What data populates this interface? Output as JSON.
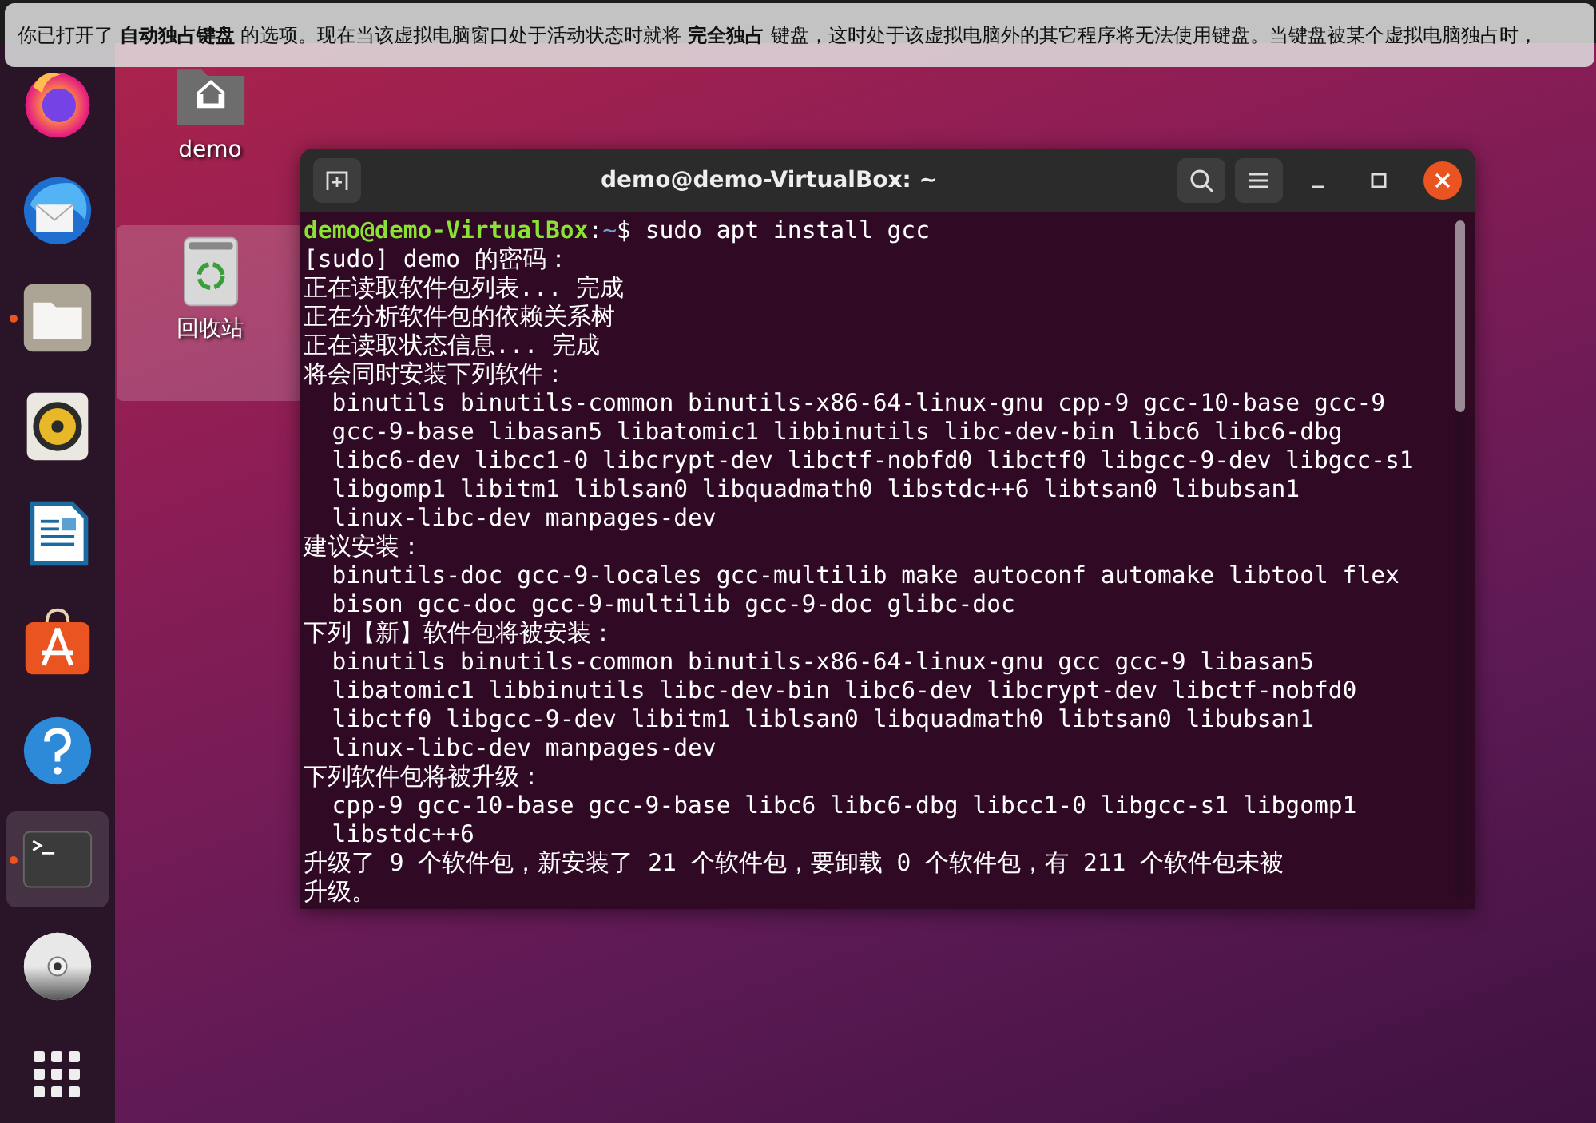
{
  "notification": {
    "text": "你已打开了 **自动独占键盘** 的选项。现在当该虚拟电脑窗口处于活动状态时就将 **完全独占** 键盘，这时处于该虚拟电脑外的其它程序将无法使用键盘。当键盘被某个虚拟电脑独占时，"
  },
  "dock": {
    "items": [
      {
        "kind": "firefox",
        "running": false,
        "selected": false
      },
      {
        "kind": "thunderbird",
        "running": false,
        "selected": false
      },
      {
        "kind": "files",
        "running": true,
        "selected": false
      },
      {
        "kind": "rhythmbox",
        "running": false,
        "selected": false
      },
      {
        "kind": "writer",
        "running": false,
        "selected": false
      },
      {
        "kind": "software",
        "running": false,
        "selected": false
      },
      {
        "kind": "help",
        "running": false,
        "selected": false
      },
      {
        "kind": "terminal",
        "running": true,
        "selected": true
      },
      {
        "kind": "disc",
        "running": false,
        "selected": false
      },
      {
        "kind": "apps",
        "running": false,
        "selected": false
      }
    ]
  },
  "desktop": {
    "icons": [
      {
        "kind": "home",
        "label": "demo",
        "selected": false
      },
      {
        "kind": "trash",
        "label": "回收站",
        "selected": true
      }
    ]
  },
  "terminal": {
    "title": "demo@demo-VirtualBox: ~",
    "lines": [
      {
        "kind": "prompt",
        "segments": [
          {
            "text": "demo@demo-VirtualBox",
            "color": "#8ae234"
          },
          {
            "text": ":",
            "color": "#ffffff"
          },
          {
            "text": "~",
            "color": "#729fcf"
          },
          {
            "text": "$ sudo apt install gcc",
            "color": "#ffffff"
          }
        ]
      },
      {
        "kind": "text",
        "text": "[sudo] demo 的密码："
      },
      {
        "kind": "text",
        "text": "正在读取软件包列表... 完成"
      },
      {
        "kind": "text",
        "text": "正在分析软件包的依赖关系树"
      },
      {
        "kind": "text",
        "text": "正在读取状态信息... 完成"
      },
      {
        "kind": "text",
        "text": "将会同时安装下列软件："
      },
      {
        "kind": "package",
        "text": "binutils binutils-common binutils-x86-64-linux-gnu cpp-9 gcc-10-base gcc-9"
      },
      {
        "kind": "package",
        "text": "gcc-9-base libasan5 libatomic1 libbinutils libc-dev-bin libc6 libc6-dbg"
      },
      {
        "kind": "package",
        "text": "libc6-dev libcc1-0 libcrypt-dev libctf-nobfd0 libctf0 libgcc-9-dev libgcc-s1"
      },
      {
        "kind": "package",
        "text": "libgomp1 libitm1 liblsan0 libquadmath0 libstdc++6 libtsan0 libubsan1"
      },
      {
        "kind": "package",
        "text": "linux-libc-dev manpages-dev"
      },
      {
        "kind": "text",
        "text": "建议安装："
      },
      {
        "kind": "package",
        "text": "binutils-doc gcc-9-locales gcc-multilib make autoconf automake libtool flex"
      },
      {
        "kind": "package",
        "text": "bison gcc-doc gcc-9-multilib gcc-9-doc glibc-doc"
      },
      {
        "kind": "text",
        "text": "下列【新】软件包将被安装："
      },
      {
        "kind": "package",
        "text": "binutils binutils-common binutils-x86-64-linux-gnu gcc gcc-9 libasan5"
      },
      {
        "kind": "package",
        "text": "libatomic1 libbinutils libc-dev-bin libc6-dev libcrypt-dev libctf-nobfd0"
      },
      {
        "kind": "package",
        "text": "libctf0 libgcc-9-dev libitm1 liblsan0 libquadmath0 libtsan0 libubsan1"
      },
      {
        "kind": "package",
        "text": "linux-libc-dev manpages-dev"
      },
      {
        "kind": "text",
        "text": "下列软件包将被升级："
      },
      {
        "kind": "package",
        "text": "cpp-9 gcc-10-base gcc-9-base libc6 libc6-dbg libcc1-0 libgcc-s1 libgomp1"
      },
      {
        "kind": "package",
        "text": "libstdc++6"
      },
      {
        "kind": "text",
        "text": "升级了 9 个软件包，新安装了 21 个软件包，要卸载 0 个软件包，有 211 个软件包未被"
      },
      {
        "kind": "text",
        "text": "升级。"
      }
    ]
  }
}
